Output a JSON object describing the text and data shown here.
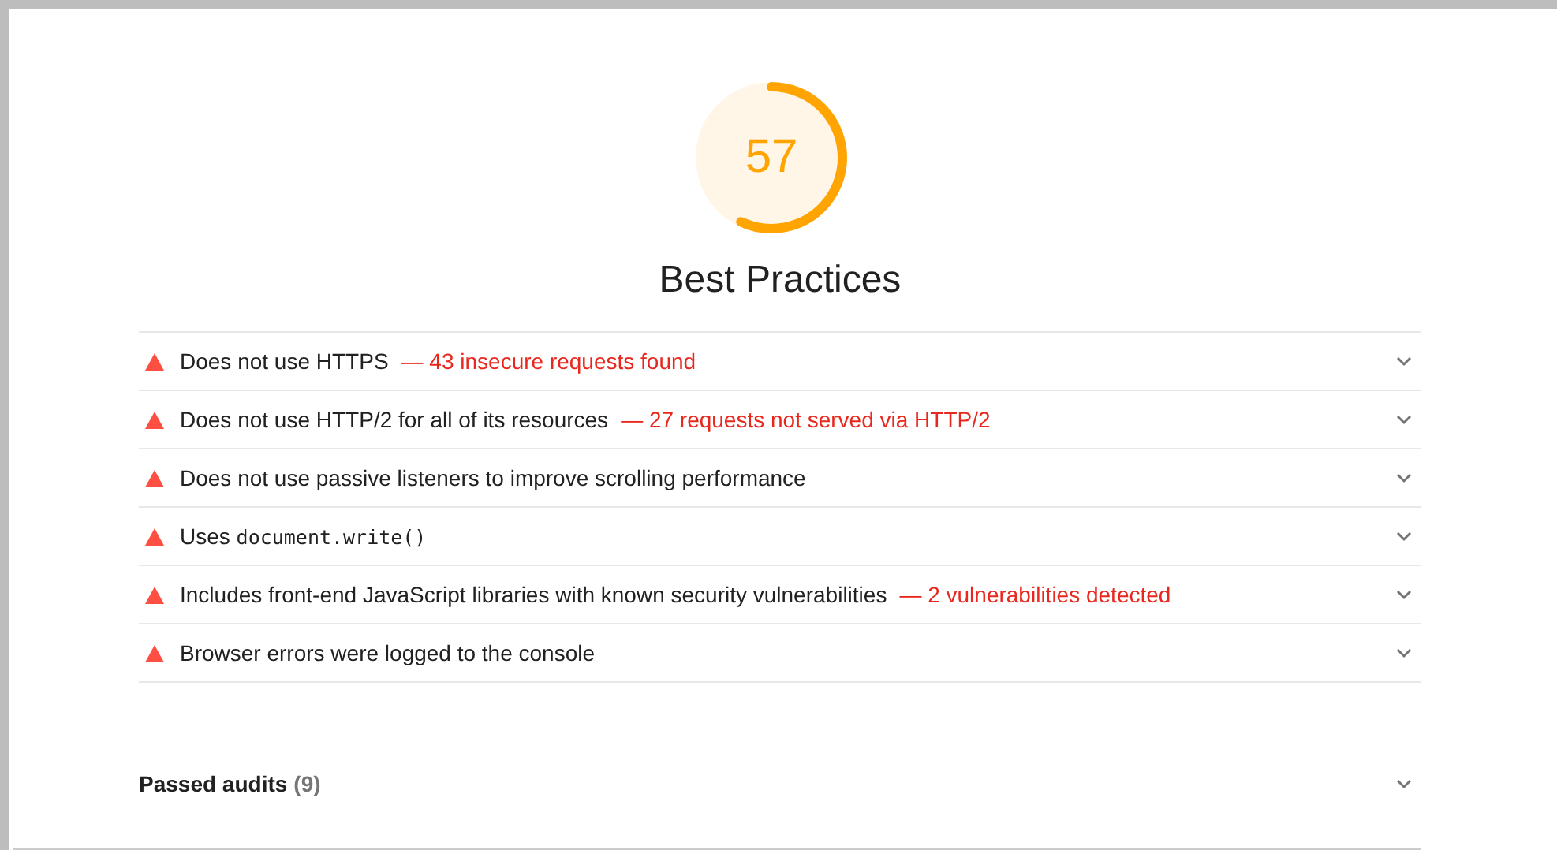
{
  "gauge": {
    "score": "57",
    "level": 0.57
  },
  "category": {
    "title": "Best Practices"
  },
  "audits": [
    {
      "title": [
        {
          "kind": "text",
          "text": "Does not use HTTPS"
        }
      ],
      "detail": "— 43 insecure requests found",
      "expanded": false
    },
    {
      "title": [
        {
          "kind": "text",
          "text": "Does not use HTTP/2 for all of its resources"
        }
      ],
      "detail": "— 27 requests not served via HTTP/2",
      "expanded": false
    },
    {
      "title": [
        {
          "kind": "text",
          "text": "Does not use passive listeners to improve scrolling performance"
        }
      ],
      "expanded": false
    },
    {
      "title": [
        {
          "kind": "text",
          "text": "Uses "
        },
        {
          "kind": "code",
          "text": "document.write()"
        }
      ],
      "expanded": false
    },
    {
      "title": [
        {
          "kind": "text",
          "text": "Includes front-end JavaScript libraries with known security vulnerabilities"
        }
      ],
      "detail": "— 2 vulnerabilities detected",
      "expanded": false
    },
    {
      "title": [
        {
          "kind": "text",
          "text": "Browser errors were logged to the console"
        }
      ],
      "expanded": false
    }
  ],
  "passed": {
    "label": "Passed audits",
    "count": "(9)",
    "expanded": false
  }
}
